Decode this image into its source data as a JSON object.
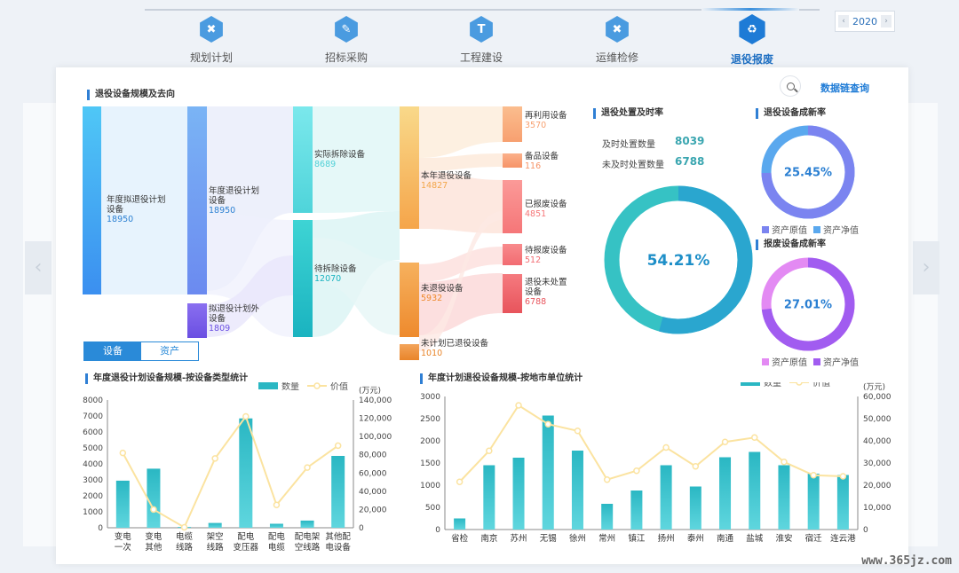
{
  "stepper": {
    "steps": [
      {
        "label": "规划计划",
        "icon": "tools-icon",
        "glyph": "✖"
      },
      {
        "label": "招标采购",
        "icon": "document-icon",
        "glyph": "✎"
      },
      {
        "label": "工程建设",
        "icon": "hammer-icon",
        "glyph": "T"
      },
      {
        "label": "运维检修",
        "icon": "wrench-icon",
        "glyph": "✖"
      },
      {
        "label": "退役报废",
        "icon": "recycle-doc-icon",
        "glyph": "♻"
      }
    ],
    "active_index": 4
  },
  "year": {
    "value": "2020",
    "prev": "‹",
    "next": "›"
  },
  "nav": {
    "left": "‹",
    "right": "›"
  },
  "panel": {
    "sankey_title": "退役设备规模及去向",
    "data_chain_link": "数据链查询",
    "tabs": [
      "设备",
      "资产"
    ],
    "active_tab": 0
  },
  "sankey": {
    "nodes": [
      {
        "id": "n1",
        "label": "年度拟退役计划设备",
        "value": "18950"
      },
      {
        "id": "n2",
        "label": "年度退役计划设备",
        "value": "18950"
      },
      {
        "id": "n3",
        "label": "拟退役计划外设备",
        "value": "1809"
      },
      {
        "id": "n4",
        "label": "实际拆除设备",
        "value": "8689"
      },
      {
        "id": "n5",
        "label": "待拆除设备",
        "value": "12070"
      },
      {
        "id": "n6",
        "label": "本年退役设备",
        "value": "14827"
      },
      {
        "id": "n7",
        "label": "未退役设备",
        "value": "5932"
      },
      {
        "id": "n8",
        "label": "未计划已退役设备",
        "value": "1010"
      },
      {
        "id": "n9",
        "label": "再利用设备",
        "value": "3570"
      },
      {
        "id": "n10",
        "label": "备品设备",
        "value": "116"
      },
      {
        "id": "n11",
        "label": "已报废设备",
        "value": "4851"
      },
      {
        "id": "n12",
        "label": "待报废设备",
        "value": "512"
      },
      {
        "id": "n13",
        "label": "退役未处置设备",
        "value": "6788"
      }
    ]
  },
  "disposal": {
    "title": "退役处置及时率",
    "timely_label": "及时处置数量",
    "timely_value": "8039",
    "late_label": "未及时处置数量",
    "late_value": "6788",
    "percent": "54.21%",
    "fraction": 0.5421,
    "colors": {
      "main": "#2aa6cf",
      "rest": "#36c2c4"
    }
  },
  "renew_retired": {
    "title": "退役设备成新率",
    "percent": "25.45%",
    "fraction": 0.2545,
    "legend": [
      "资产原值",
      "资产净值"
    ],
    "colors": {
      "a": "#7b84f0",
      "b": "#5aa8ee"
    }
  },
  "renew_scrap": {
    "title": "报废设备成新率",
    "percent": "27.01%",
    "fraction": 0.2701,
    "legend": [
      "资产原值",
      "资产净值"
    ],
    "colors": {
      "a": "#e38af3",
      "b": "#a15cf0"
    }
  },
  "chart_data": [
    {
      "type": "bar",
      "title": "年度退役计划设备规模-按设备类型统计",
      "categories": [
        "变电\n一次",
        "变电\n其他",
        "电缆\n线路",
        "架空\n线路",
        "配电\n变压器",
        "配电\n电缆",
        "配电架\n空线路",
        "其他配\n电设备"
      ],
      "series": [
        {
          "name": "数量",
          "type": "bar",
          "axis": "left",
          "values": [
            2950,
            3700,
            50,
            300,
            6850,
            250,
            450,
            4500
          ]
        },
        {
          "name": "价值",
          "type": "line",
          "axis": "right",
          "values": [
            82000,
            20000,
            500,
            76000,
            122000,
            25000,
            66000,
            90000
          ]
        }
      ],
      "ylim_left": [
        0,
        8000
      ],
      "yticks_left": [
        "0",
        "1000",
        "2000",
        "3000",
        "4000",
        "5000",
        "6000",
        "7000",
        "8000"
      ],
      "ylim_right": [
        0,
        140000
      ],
      "yticks_right": [
        "0",
        "20,000",
        "40,000",
        "60,000",
        "80,000",
        "100,000",
        "120,000",
        "140,000"
      ],
      "right_unit": "(万元)",
      "legend": [
        "数量",
        "价值"
      ],
      "colors": {
        "bar": "#2ab7c3",
        "line": "#fbe3a0"
      }
    },
    {
      "type": "bar",
      "title": "年度计划退役设备规模-按地市单位统计",
      "categories": [
        "省检",
        "南京",
        "苏州",
        "无锡",
        "徐州",
        "常州",
        "镇江",
        "扬州",
        "泰州",
        "南通",
        "盐城",
        "淮安",
        "宿迁",
        "连云港"
      ],
      "series": [
        {
          "name": "数量",
          "type": "bar",
          "axis": "left",
          "values": [
            250,
            1450,
            1620,
            2570,
            1780,
            580,
            880,
            1450,
            970,
            1630,
            1750,
            1450,
            1260,
            1230
          ]
        },
        {
          "name": "价值",
          "type": "line",
          "axis": "right",
          "values": [
            21500,
            35500,
            56000,
            47500,
            44500,
            22500,
            26500,
            37000,
            28500,
            39500,
            41500,
            30500,
            24500,
            24000
          ]
        }
      ],
      "ylim_left": [
        0,
        3000
      ],
      "yticks_left": [
        "0",
        "500",
        "1000",
        "1500",
        "2000",
        "2500",
        "3000"
      ],
      "ylim_right": [
        0,
        60000
      ],
      "yticks_right": [
        "0",
        "10,000",
        "20,000",
        "30,000",
        "40,000",
        "50,000",
        "60,000"
      ],
      "right_unit": "(万元)",
      "legend": [
        "数量",
        "价值"
      ],
      "colors": {
        "bar": "#2ab7c3",
        "line": "#fbe3a0"
      }
    }
  ],
  "watermark": "www.365jz.com"
}
